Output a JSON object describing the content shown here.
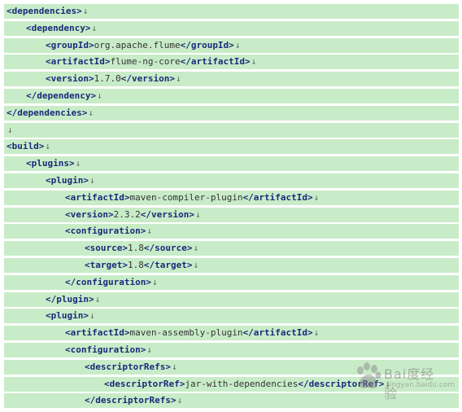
{
  "code_lines": [
    {
      "indent": 0,
      "open": "<dependencies>",
      "text": "",
      "close": ""
    },
    {
      "indent": 1,
      "open": "<dependency>",
      "text": "",
      "close": ""
    },
    {
      "indent": 2,
      "open": "<groupId>",
      "text": "org.apache.flume",
      "close": "</groupId>"
    },
    {
      "indent": 2,
      "open": "<artifactId>",
      "text": "flume-ng-core",
      "close": "</artifactId>"
    },
    {
      "indent": 2,
      "open": "<version>",
      "text": "1.7.0",
      "close": "</version>"
    },
    {
      "indent": 1,
      "open": "</dependency>",
      "text": "",
      "close": ""
    },
    {
      "indent": 0,
      "open": "</dependencies>",
      "text": "",
      "close": ""
    },
    {
      "indent": 0,
      "open": "",
      "text": "",
      "close": ""
    },
    {
      "indent": 0,
      "open": "<build>",
      "text": "",
      "close": ""
    },
    {
      "indent": 1,
      "open": "<plugins>",
      "text": "",
      "close": ""
    },
    {
      "indent": 2,
      "open": "<plugin>",
      "text": "",
      "close": ""
    },
    {
      "indent": 3,
      "open": "<artifactId>",
      "text": "maven-compiler-plugin",
      "close": "</artifactId>"
    },
    {
      "indent": 3,
      "open": "<version>",
      "text": "2.3.2",
      "close": "</version>"
    },
    {
      "indent": 3,
      "open": "<configuration>",
      "text": "",
      "close": ""
    },
    {
      "indent": 4,
      "open": "<source>",
      "text": "1.8",
      "close": "</source>"
    },
    {
      "indent": 4,
      "open": "<target>",
      "text": "1.8",
      "close": "</target>"
    },
    {
      "indent": 3,
      "open": "</configuration>",
      "text": "",
      "close": ""
    },
    {
      "indent": 2,
      "open": "</plugin>",
      "text": "",
      "close": ""
    },
    {
      "indent": 2,
      "open": "<plugin>",
      "text": "",
      "close": ""
    },
    {
      "indent": 3,
      "open": "<artifactId>",
      "text": "maven-assembly-plugin",
      "close": "</artifactId>"
    },
    {
      "indent": 3,
      "open": "<configuration>",
      "text": "",
      "close": ""
    },
    {
      "indent": 4,
      "open": "<descriptorRefs>",
      "text": "",
      "close": ""
    },
    {
      "indent": 5,
      "open": "<descriptorRef>",
      "text": "jar-with-dependencies",
      "close": "</descriptorRef>"
    },
    {
      "indent": 4,
      "open": "</descriptorRefs>",
      "text": "",
      "close": ""
    }
  ],
  "line_return_glyph": "↓",
  "watermark": {
    "icon": "baidu-paw-icon",
    "label": "Bai度经验",
    "sub": "jingyan.baidu.com"
  },
  "colors": {
    "line_background": "#c8ecc8",
    "tag_text": "#1a2a7a",
    "content_text": "#333333"
  }
}
